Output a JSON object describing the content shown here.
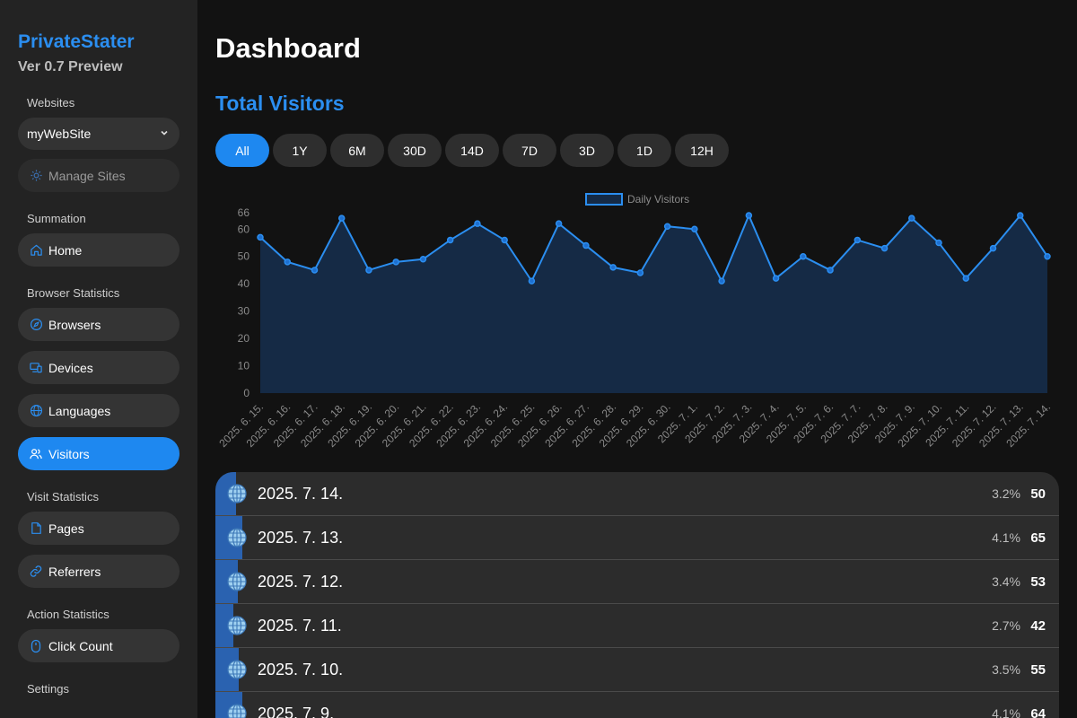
{
  "sidebar": {
    "brand": "PrivateStater",
    "version": "Ver 0.7 Preview",
    "websites_label": "Websites",
    "selected_site": "myWebSite",
    "manage_sites": "Manage Sites",
    "summation_label": "Summation",
    "home": "Home",
    "browser_stats_label": "Browser Statistics",
    "browsers": "Browsers",
    "devices": "Devices",
    "languages": "Languages",
    "visitors": "Visitors",
    "visit_stats_label": "Visit Statistics",
    "pages": "Pages",
    "referrers": "Referrers",
    "action_stats_label": "Action Statistics",
    "click_count": "Click Count",
    "settings_label": "Settings"
  },
  "main": {
    "title": "Dashboard",
    "section_title": "Total Visitors",
    "ranges": [
      "All",
      "1Y",
      "6M",
      "30D",
      "14D",
      "7D",
      "3D",
      "1D",
      "12H"
    ],
    "active_range": "All"
  },
  "colors": {
    "accent": "#1e88f0",
    "line": "#2b8ef0",
    "fill": "#152a45"
  },
  "chart_data": {
    "type": "area",
    "legend": "Daily Visitors",
    "legend_position": "top-center",
    "categories": [
      "2025. 6. 15.",
      "2025. 6. 16.",
      "2025. 6. 17.",
      "2025. 6. 18.",
      "2025. 6. 19.",
      "2025. 6. 20.",
      "2025. 6. 21.",
      "2025. 6. 22.",
      "2025. 6. 23.",
      "2025. 6. 24.",
      "2025. 6. 25.",
      "2025. 6. 26.",
      "2025. 6. 27.",
      "2025. 6. 28.",
      "2025. 6. 29.",
      "2025. 6. 30.",
      "2025. 7. 1.",
      "2025. 7. 2.",
      "2025. 7. 3.",
      "2025. 7. 4.",
      "2025. 7. 5.",
      "2025. 7. 6.",
      "2025. 7. 7.",
      "2025. 7. 8.",
      "2025. 7. 9.",
      "2025. 7. 10.",
      "2025. 7. 11.",
      "2025. 7. 12.",
      "2025. 7. 13.",
      "2025. 7. 14."
    ],
    "values": [
      57,
      48,
      45,
      64,
      45,
      48,
      49,
      56,
      62,
      56,
      41,
      62,
      54,
      46,
      44,
      61,
      60,
      41,
      65,
      42,
      50,
      45,
      56,
      53,
      64,
      55,
      42,
      53,
      65,
      50
    ],
    "yticks": [
      0,
      10,
      20,
      30,
      40,
      50,
      60,
      66
    ],
    "ylim": [
      0,
      66
    ],
    "grid": false
  },
  "table": {
    "rows": [
      {
        "date": "2025. 7. 14.",
        "pct": "3.2%",
        "count": "50",
        "share": 0.032
      },
      {
        "date": "2025. 7. 13.",
        "pct": "4.1%",
        "count": "65",
        "share": 0.041
      },
      {
        "date": "2025. 7. 12.",
        "pct": "3.4%",
        "count": "53",
        "share": 0.034
      },
      {
        "date": "2025. 7. 11.",
        "pct": "2.7%",
        "count": "42",
        "share": 0.027
      },
      {
        "date": "2025. 7. 10.",
        "pct": "3.5%",
        "count": "55",
        "share": 0.035
      },
      {
        "date": "2025. 7. 9.",
        "pct": "4.1%",
        "count": "64",
        "share": 0.041
      }
    ]
  }
}
